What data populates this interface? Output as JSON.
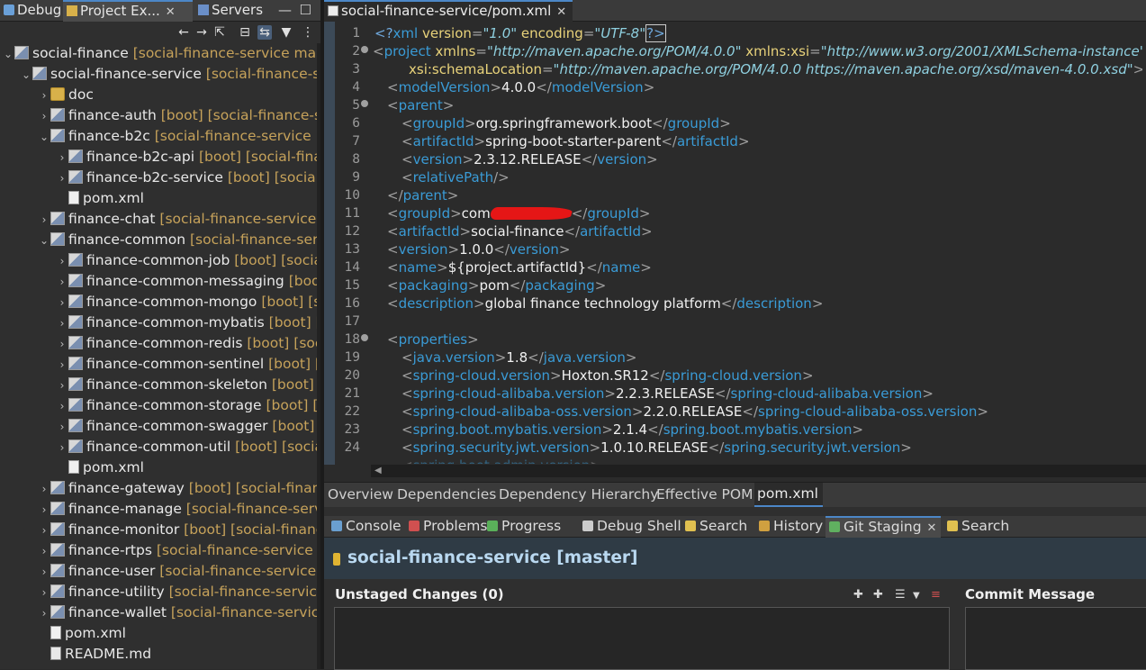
{
  "left_tabs": [
    {
      "label": "Debug"
    },
    {
      "label": "Project Ex..."
    },
    {
      "label": "Servers"
    }
  ],
  "tree": [
    {
      "chev": "⌄",
      "icon": "proj",
      "name": "social-finance",
      "dec": "[social-finance-service master"
    },
    {
      "chev": "⌄",
      "icon": "proj",
      "name": "social-finance-service",
      "dec": "[social-finance-serv"
    },
    {
      "chev": "›",
      "icon": "folder",
      "name": "doc",
      "dec": ""
    },
    {
      "chev": "›",
      "icon": "proj",
      "name": "finance-auth",
      "dec": "[boot] [social-finance-ser"
    },
    {
      "chev": "⌄",
      "icon": "proj",
      "name": "finance-b2c",
      "dec": "[social-finance-service ma"
    },
    {
      "chev": "›",
      "icon": "proj",
      "name": "finance-b2c-api",
      "dec": "[boot] [social-financ"
    },
    {
      "chev": "›",
      "icon": "proj",
      "name": "finance-b2c-service",
      "dec": "[boot] [social-fi"
    },
    {
      "chev": "",
      "icon": "file",
      "name": "pom.xml",
      "dec": ""
    },
    {
      "chev": "›",
      "icon": "proj",
      "name": "finance-chat",
      "dec": "[social-finance-service ma"
    },
    {
      "chev": "⌄",
      "icon": "proj",
      "name": "finance-common",
      "dec": "[social-finance-servic"
    },
    {
      "chev": "›",
      "icon": "proj",
      "name": "finance-common-job",
      "dec": "[boot] [social-"
    },
    {
      "chev": "›",
      "icon": "proj",
      "name": "finance-common-messaging",
      "dec": "[boot]"
    },
    {
      "chev": "›",
      "icon": "proj",
      "name": "finance-common-mongo",
      "dec": "[boot] [so"
    },
    {
      "chev": "›",
      "icon": "proj",
      "name": "finance-common-mybatis",
      "dec": "[boot] [s"
    },
    {
      "chev": "›",
      "icon": "proj",
      "name": "finance-common-redis",
      "dec": "[boot] [socia"
    },
    {
      "chev": "›",
      "icon": "proj",
      "name": "finance-common-sentinel",
      "dec": "[boot] [so"
    },
    {
      "chev": "›",
      "icon": "proj",
      "name": "finance-common-skeleton",
      "dec": "[boot] [s"
    },
    {
      "chev": "›",
      "icon": "proj",
      "name": "finance-common-storage",
      "dec": "[boot] [so"
    },
    {
      "chev": "›",
      "icon": "proj",
      "name": "finance-common-swagger",
      "dec": "[boot] [s"
    },
    {
      "chev": "›",
      "icon": "proj",
      "name": "finance-common-util",
      "dec": "[boot] [social-"
    },
    {
      "chev": "",
      "icon": "file",
      "name": "pom.xml",
      "dec": ""
    },
    {
      "chev": "›",
      "icon": "proj",
      "name": "finance-gateway",
      "dec": "[boot] [social-finance"
    },
    {
      "chev": "›",
      "icon": "proj",
      "name": "finance-manage",
      "dec": "[social-finance-service"
    },
    {
      "chev": "›",
      "icon": "proj",
      "name": "finance-monitor",
      "dec": "[boot] [social-finance"
    },
    {
      "chev": "›",
      "icon": "proj",
      "name": "finance-rtps",
      "dec": "[social-finance-service ma"
    },
    {
      "chev": "›",
      "icon": "proj",
      "name": "finance-user",
      "dec": "[social-finance-service ma"
    },
    {
      "chev": "›",
      "icon": "proj",
      "name": "finance-utility",
      "dec": "[social-finance-service n"
    },
    {
      "chev": "›",
      "icon": "proj",
      "name": "finance-wallet",
      "dec": "[social-finance-service r"
    },
    {
      "chev": "",
      "icon": "file",
      "name": "pom.xml",
      "dec": ""
    },
    {
      "chev": "",
      "icon": "md",
      "name": "README.md",
      "dec": ""
    }
  ],
  "editor": {
    "tab_title": "social-finance-service/pom.xml",
    "line_numbers": [
      "1",
      "2",
      "3",
      "4",
      "5",
      "6",
      "7",
      "8",
      "9",
      "10",
      "11",
      "12",
      "13",
      "14",
      "15",
      "16",
      "17",
      "18",
      "19",
      "20",
      "21",
      "22",
      "23",
      "24"
    ],
    "fold_lines": [
      2,
      5,
      18
    ],
    "decl_version": "\"1.0\"",
    "decl_encoding": "\"UTF-8\"",
    "xmlns": "\"http://maven.apache.org/POM/4.0.0\"",
    "xmlns_xsi": "\"http://www.w3.org/2001/XMLSchema-instance\"",
    "schema_location": "\"http://maven.apache.org/POM/4.0.0 https://maven.apache.org/xsd/maven-4.0.0.xsd\"",
    "model_version": "4.0.0",
    "parent_group": "org.springframework.boot",
    "parent_artifact": "spring-boot-starter-parent",
    "parent_version": "2.3.12.RELEASE",
    "group_id_visible": "com",
    "artifact_id": "social-finance",
    "version": "1.0.0",
    "name": "${project.artifactId}",
    "packaging": "pom",
    "description": "global finance technology platform",
    "props": [
      {
        "tag": "java.version",
        "value": "1.8"
      },
      {
        "tag": "spring-cloud.version",
        "value": "Hoxton.SR12"
      },
      {
        "tag": "spring-cloud-alibaba.version",
        "value": "2.2.3.RELEASE"
      },
      {
        "tag": "spring-cloud-alibaba-oss.version",
        "value": "2.2.0.RELEASE"
      },
      {
        "tag": "spring.boot.mybatis.version",
        "value": "2.1.4"
      },
      {
        "tag": "spring.security.jwt.version",
        "value": "1.0.10.RELEASE"
      }
    ]
  },
  "pom_tabs": [
    "Overview",
    "Dependencies",
    "Dependency Hierarchy",
    "Effective POM",
    "pom.xml"
  ],
  "view_tabs": [
    "Console",
    "Problems",
    "Progress",
    "Debug Shell",
    "Search",
    "History",
    "Git Staging",
    "Search"
  ],
  "staging": {
    "title": "social-finance-service [master]",
    "unstaged_label": "Unstaged Changes (0)",
    "commit_label": "Commit Message"
  },
  "colors": {
    "tag": "#3a9bd6",
    "attr": "#e8d27a",
    "accent": "#4c87c7"
  }
}
